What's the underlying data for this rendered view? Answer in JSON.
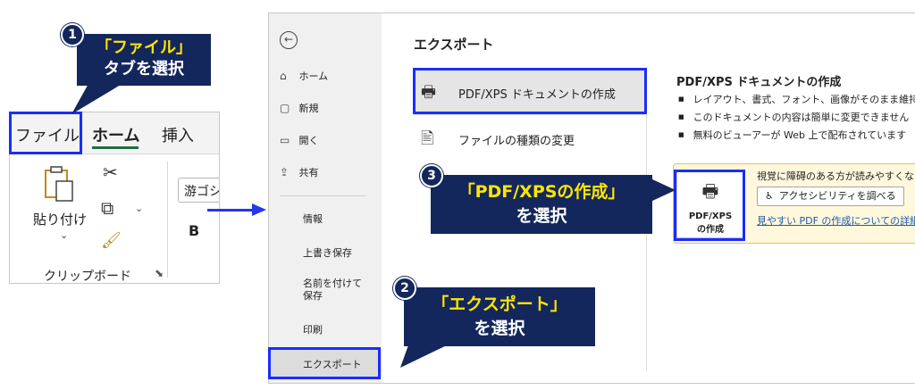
{
  "ribbon": {
    "tabs": {
      "file": "ファイル",
      "home": "ホーム",
      "insert": "挿入"
    },
    "paste_label": "貼り付け",
    "clipboard_group": "クリップボード",
    "font_name": "游ゴシ",
    "bold_label": "B"
  },
  "callouts": {
    "step1": {
      "number": "1",
      "line1": "「ファイル」",
      "line2": "タブを選択"
    },
    "step2": {
      "number": "2",
      "line1": "「エクスポート」",
      "line2": "を選択"
    },
    "step3": {
      "number": "3",
      "line1": "「PDF/XPSの作成」",
      "line2": "を選択"
    }
  },
  "backstage": {
    "nav": {
      "back_icon": "←",
      "items": [
        {
          "icon": "⌂",
          "label": "ホーム"
        },
        {
          "icon": "▢",
          "label": "新規"
        },
        {
          "icon": "▭",
          "label": "開く"
        },
        {
          "icon": "⇪",
          "label": "共有"
        }
      ],
      "text_items": [
        "情報",
        "上書き保存",
        "名前を付けて\n保存",
        "印刷",
        "エクスポート"
      ]
    },
    "title": "エクスポート",
    "options": [
      {
        "icon": "🖶",
        "label": "PDF/XPS ドキュメントの作成"
      },
      {
        "icon": "🖹",
        "label": "ファイルの種類の変更"
      }
    ],
    "pdf": {
      "title": "PDF/XPS ドキュメントの作成",
      "bullets": [
        "レイアウト、書式、フォント、画像がそのまま維持されます",
        "このドキュメントの内容は簡単に変更できません",
        "無料のビューアーが Web 上で配布されています"
      ],
      "button_line1": "PDF/XPS",
      "button_line2": "の作成",
      "accessibility_text": "視覚に障碍のある方が読みやすくなるよう",
      "accessibility_button": "アクセシビリティを調べる",
      "link": "見やすい PDF の作成についての詳細を見"
    }
  },
  "colors": {
    "callout_bg": "#13275c",
    "callout_accent": "#ffe600",
    "highlight": "#1a2cff",
    "panel_bg": "#fff8dc"
  }
}
